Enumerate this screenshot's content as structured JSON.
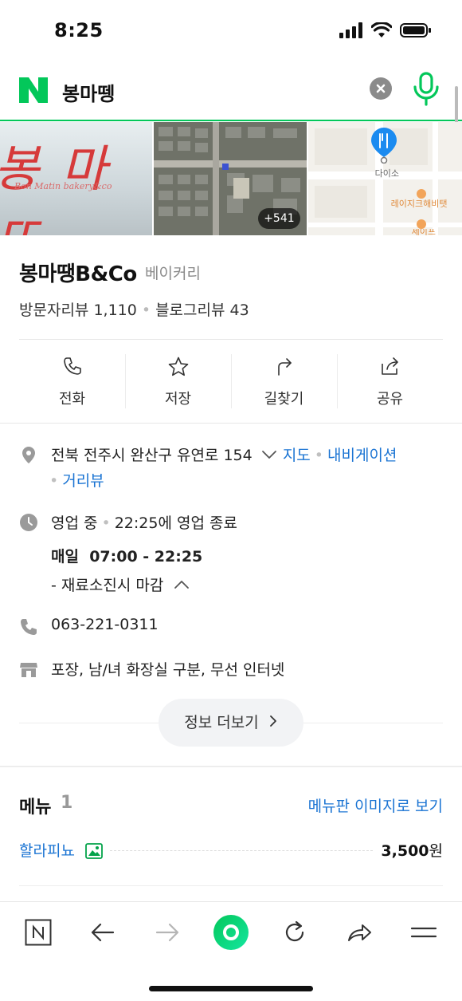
{
  "status_bar": {
    "time": "8:25"
  },
  "search": {
    "query": "봉마뗑"
  },
  "photos": {
    "sign_text": "봉 마 뜨",
    "sign_subtext": "Bon Matin bakery&co",
    "more_count": "+541",
    "map_label_1": "다이소",
    "map_label_2": "레이지크해비탯",
    "map_label_3": "세이프"
  },
  "place": {
    "name": "봉마땡B&Co",
    "category": "베이커리",
    "visitor_reviews": "방문자리뷰 1,110",
    "blog_reviews": "블로그리뷰 43"
  },
  "actions": [
    {
      "label": "전화",
      "icon": "phone-icon"
    },
    {
      "label": "저장",
      "icon": "star-icon"
    },
    {
      "label": "길찾기",
      "icon": "directions-icon"
    },
    {
      "label": "공유",
      "icon": "share-icon"
    }
  ],
  "info": {
    "address": "전북 전주시 완산구 유연로 154",
    "map_link": "지도",
    "navigation_link": "내비게이션",
    "street_view_link": "거리뷰",
    "status": "영업 중",
    "closing": "22:25에 영업 종료",
    "days": "매일",
    "hours": "07:00 - 22:25",
    "note": "- 재료소진시 마감",
    "phone": "063-221-0311",
    "amenities": "포장, 남/녀 화장실 구분, 무선 인터넷",
    "more_button": "정보 더보기"
  },
  "menu": {
    "title": "메뉴",
    "count": "1",
    "view_image_link": "메뉴판 이미지로 보기",
    "items": [
      {
        "name": "할라피뇨",
        "price": "3,500",
        "unit": "원"
      }
    ]
  },
  "colors": {
    "accent": "#03c75a",
    "link": "#1b74d3"
  }
}
